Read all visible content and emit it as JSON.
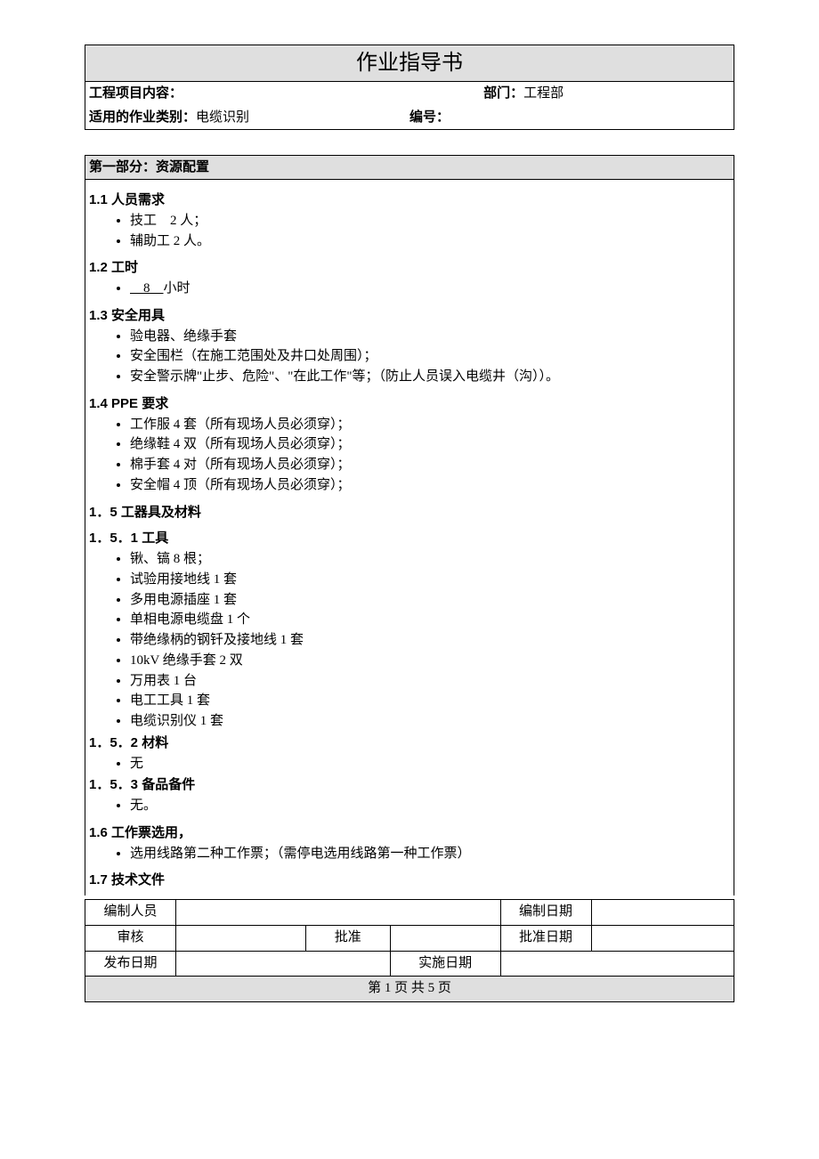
{
  "header": {
    "title": "作业指导书",
    "projectLabel": "工程项目内容：",
    "projectValue": "",
    "deptLabel": "部门：",
    "deptValue": "工程部",
    "jobTypeLabel": "适用的作业类别：",
    "jobTypeValue": "电缆识别",
    "codeLabel": "编号：",
    "codeValue": ""
  },
  "section1": {
    "title": "第一部分：资源配置",
    "s11": {
      "title": "1.1 人员需求",
      "items": [
        "技工　2 人；",
        "辅助工 2 人。"
      ]
    },
    "s12": {
      "title": "1.2 工时",
      "prefix": "　",
      "value": "8",
      "suffix": "　小时"
    },
    "s13": {
      "title": "1.3 安全用具",
      "items": [
        "验电器、绝缘手套",
        "安全围栏（在施工范围处及井口处周围）；",
        "安全警示牌\"止步、危险\"、\"在此工作\"等；（防止人员误入电缆井（沟））。"
      ]
    },
    "s14": {
      "title": "1.4 PPE 要求",
      "items": [
        "工作服 4 套（所有现场人员必须穿）；",
        "绝缘鞋 4 双（所有现场人员必须穿）；",
        "棉手套 4 对（所有现场人员必须穿）；",
        "安全帽 4 顶（所有现场人员必须穿）；"
      ]
    },
    "s15": {
      "title": "1．5 工器具及材料"
    },
    "s151": {
      "title": "1．5．1 工具",
      "items": [
        "锹、镐 8 根；",
        "试验用接地线 1 套",
        "多用电源插座 1 套",
        "单相电源电缆盘 1 个",
        "带绝缘柄的钢钎及接地线 1 套",
        "10kV 绝缘手套 2 双",
        "万用表 1 台",
        "电工工具 1 套",
        "电缆识别仪 1 套"
      ]
    },
    "s152": {
      "title": "1．5．2 材料",
      "items": [
        "无"
      ]
    },
    "s153": {
      "title": "1．5．3 备品备件",
      "items": [
        "无。"
      ]
    },
    "s16": {
      "title": "1.6 工作票选用，",
      "items": [
        "选用线路第二种工作票；（需停电选用线路第一种工作票）"
      ]
    },
    "s17": {
      "title": "1.7 技术文件"
    }
  },
  "footer": {
    "author": "编制人员",
    "authorDate": "编制日期",
    "review": "审核",
    "approve": "批准",
    "approveDate": "批准日期",
    "pubDate": "发布日期",
    "implDate": "实施日期",
    "pager": "第 1 页 共 5 页"
  }
}
